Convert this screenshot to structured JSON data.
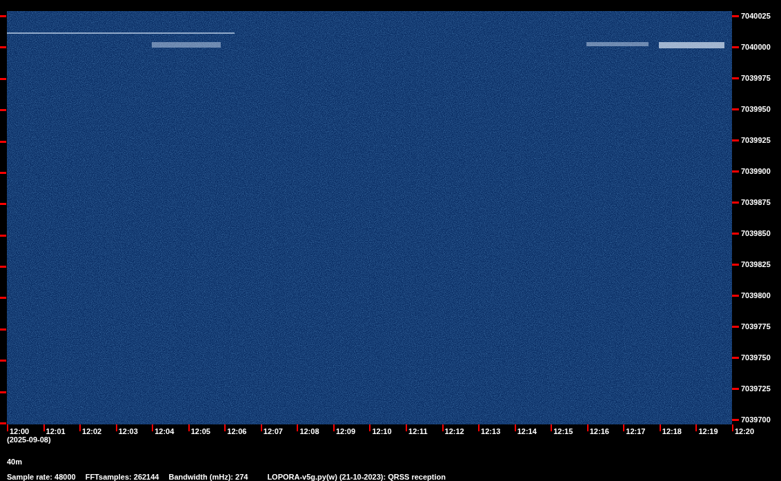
{
  "frequency_axis": {
    "labels": [
      "7040025",
      "7040000",
      "7039975",
      "7039950",
      "7039925",
      "7039900",
      "7039875",
      "7039850",
      "7039825",
      "7039800",
      "7039775",
      "7039750",
      "7039725",
      "7039700"
    ]
  },
  "time_axis": {
    "labels": [
      "12:00",
      "12:01",
      "12:02",
      "12:03",
      "12:04",
      "12:05",
      "12:06",
      "12:07",
      "12:08",
      "12:09",
      "12:10",
      "12:11",
      "12:12",
      "12:13",
      "12:14",
      "12:15",
      "12:16",
      "12:17",
      "12:18",
      "12:19",
      "12:20"
    ]
  },
  "date": "(2025-09-08)",
  "band": "40m",
  "info": [
    "Sample rate: 48000",
    "FFTsamples: 262144",
    "Bandwidth (mHz): 274"
  ],
  "program_caption": "LOPORA-v5g.py(w) (21-10-2023): QRSS reception"
}
